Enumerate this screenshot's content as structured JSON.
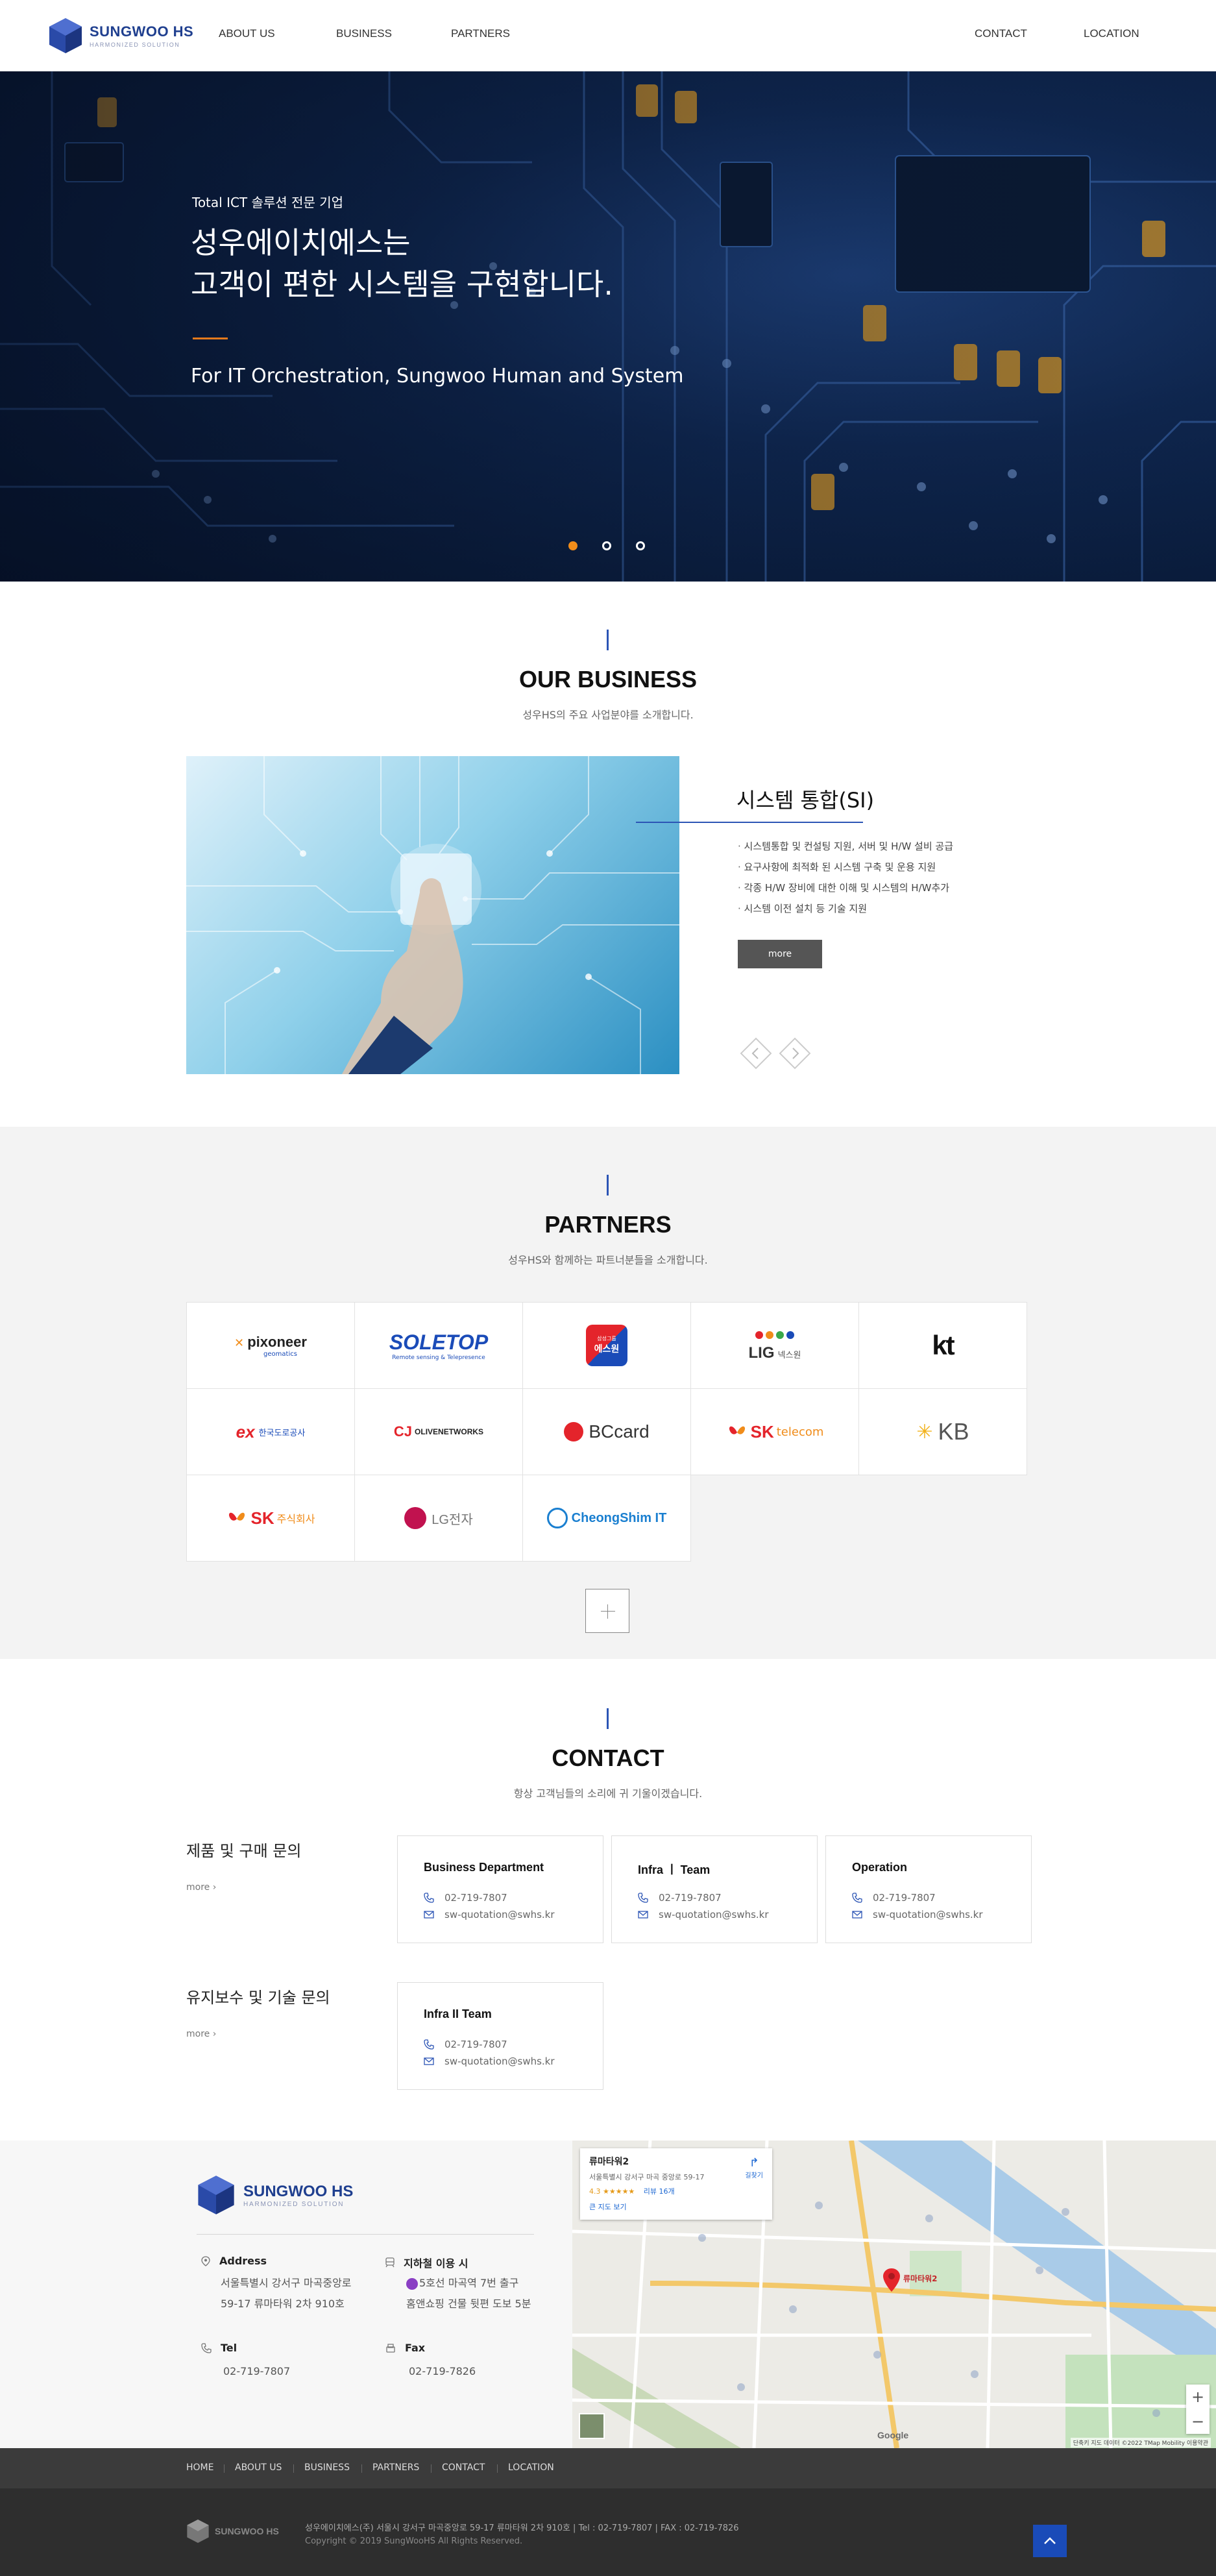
{
  "header": {
    "logo_name": "SUNGWOO HS",
    "logo_sub": "HARMONIZED SOLUTION",
    "nav_left": [
      "ABOUT US",
      "BUSINESS",
      "PARTNERS"
    ],
    "nav_right": [
      "CONTACT",
      "LOCATION"
    ]
  },
  "hero": {
    "kicker": "Total ICT 솔루션 전문 기업",
    "title_line1": "성우에이치에스는",
    "title_line2": "고객이 편한 시스템을 구현합니다.",
    "subtitle": "For IT Orchestration, Sungwoo Human and System",
    "slides": 3,
    "active_slide": 1
  },
  "business": {
    "title": "OUR BUSINESS",
    "desc": "성우HS의 주요 사업분야를 소개합니다.",
    "item_title": "시스템 통합(SI)",
    "items": [
      "시스템통합 및 컨설팅 지원, 서버 및 H/W 설비 공급",
      "요구사항에 최적화 된 시스템 구축 및 운용 지원",
      "각종 H/W 장비에 대한 이해 및 시스템의 H/W추가",
      "시스템 이전 설치 등 기술 지원"
    ],
    "more_label": "more"
  },
  "partners": {
    "title": "PARTNERS",
    "desc": "성우HS와 함께하는 파트너분들을 소개합니다.",
    "logos": [
      {
        "name": "pixoneer",
        "sub": "geomatics"
      },
      {
        "name": "SOLETOP",
        "sub": "Remote sensing & Telepresence"
      },
      {
        "name": "에스원",
        "sub": "삼성그룹"
      },
      {
        "name": "LIG",
        "sub": "넥스원"
      },
      {
        "name": "kt",
        "sub": ""
      },
      {
        "name": "ex",
        "sub": "한국도로공사"
      },
      {
        "name": "CJ",
        "sub": "OLIVENETWORKS"
      },
      {
        "name": "BCcard",
        "sub": ""
      },
      {
        "name": "SK",
        "sub": "telecom"
      },
      {
        "name": "KB",
        "sub": ""
      },
      {
        "name": "SK",
        "sub": "주식회사"
      },
      {
        "name": "LG전자",
        "sub": ""
      },
      {
        "name": "CheongShim IT",
        "sub": ""
      }
    ],
    "brand_colors": {
      "orange": "#f08c1a",
      "red": "#e4242b",
      "blue": "#1a4bb8"
    }
  },
  "contact": {
    "title": "CONTACT",
    "desc": "항상 고객님들의 소리에 귀 기울이겠습니다.",
    "groups": [
      {
        "label": "제품 및 구매 문의",
        "more": "more",
        "cards": [
          {
            "title": "Business Department",
            "tel": "02-719-7807",
            "email": "sw-quotation@swhs.kr"
          },
          {
            "title": "Infra ㅣ Team",
            "tel": "02-719-7807",
            "email": "sw-quotation@swhs.kr"
          },
          {
            "title": "Operation",
            "tel": "02-719-7807",
            "email": "sw-quotation@swhs.kr"
          }
        ]
      },
      {
        "label": "유지보수 및 기술 문의",
        "more": "more",
        "cards": [
          {
            "title": "Infra II Team",
            "tel": "02-719-7807",
            "email": "sw-quotation@swhs.kr"
          }
        ]
      }
    ]
  },
  "footer_info": {
    "address_label": "Address",
    "address_line1": "서울특별시 강서구 마곡중앙로",
    "address_line2": "59-17 류마타워 2차 910호",
    "subway_label": "지하철 이용 시",
    "subway_line1": "5호선 마곡역 7번 출구",
    "subway_line2": "홈앤쇼핑 건물 뒷편 도보 5분",
    "tel_label": "Tel",
    "tel": "02-719-7807",
    "fax_label": "Fax",
    "fax": "02-719-7826"
  },
  "map": {
    "place": "류마타워2",
    "address": "서울특별시 강서구 마곡 중앙로 59-17",
    "rating": "4.3 ★★★★★",
    "reviews": "리뷰 16개",
    "directions": "길찾기",
    "larger": "큰 지도 보기",
    "pin_label": "류마타워2",
    "attribution": "Google",
    "footer_text": "단축키  지도 데이터 ©2022 TMap Mobility  이용약관"
  },
  "bottom_nav": [
    "HOME",
    "ABOUT US",
    "BUSINESS",
    "PARTNERS",
    "CONTACT",
    "LOCATION"
  ],
  "footer": {
    "logo": "SUNGWOO HS",
    "company_line": "성우에이치에스(주)   서울시 강서구 마곡중앙로 59-17 류마타워 2차 910호   |   Tel : 02-719-7807   |   FAX : 02-719-7826",
    "copyright": "Copyright © 2019 SungWooHS All Rights Reserved."
  }
}
